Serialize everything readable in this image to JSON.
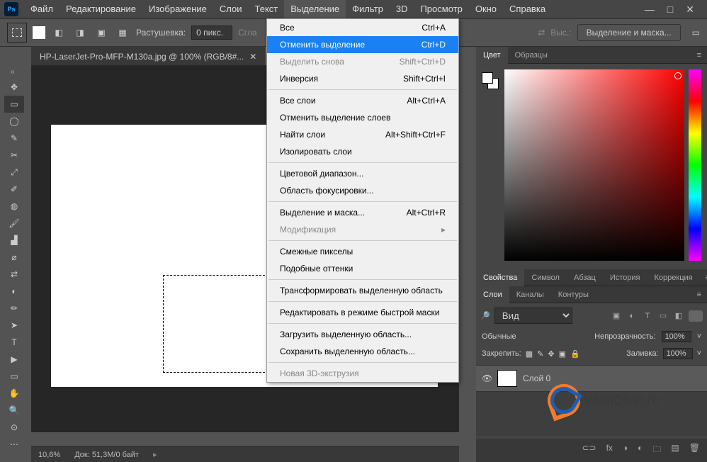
{
  "menubar": {
    "items": [
      "Файл",
      "Редактирование",
      "Изображение",
      "Слои",
      "Текст",
      "Выделение",
      "Фильтр",
      "3D",
      "Просмотр",
      "Окно",
      "Справка"
    ],
    "open_index": 5
  },
  "options": {
    "feather_label": "Растушевка:",
    "feather_value": "0 пикс.",
    "antialias_label": "Сгла",
    "refine_label": "Выс.:",
    "select_mask_btn": "Выделение и маска..."
  },
  "document": {
    "tab": "HP-LaserJet-Pro-MFP-M130a.jpg @ 100% (RGB/8#..."
  },
  "dropdown": {
    "items": [
      {
        "label": "Все",
        "shortcut": "Ctrl+A"
      },
      {
        "label": "Отменить выделение",
        "shortcut": "Ctrl+D",
        "hl": true
      },
      {
        "label": "Выделить снова",
        "shortcut": "Shift+Ctrl+D",
        "dim": true
      },
      {
        "label": "Инверсия",
        "shortcut": "Shift+Ctrl+I"
      },
      {
        "sep": true
      },
      {
        "label": "Все слои",
        "shortcut": "Alt+Ctrl+A"
      },
      {
        "label": "Отменить выделение слоев",
        "shortcut": ""
      },
      {
        "label": "Найти слои",
        "shortcut": "Alt+Shift+Ctrl+F"
      },
      {
        "label": "Изолировать слои",
        "shortcut": ""
      },
      {
        "sep": true
      },
      {
        "label": "Цветовой диапазон...",
        "shortcut": ""
      },
      {
        "label": "Область фокусировки...",
        "shortcut": ""
      },
      {
        "sep": true
      },
      {
        "label": "Выделение и маска...",
        "shortcut": "Alt+Ctrl+R"
      },
      {
        "label": "Модификация",
        "shortcut": "▸",
        "dim": true
      },
      {
        "sep": true
      },
      {
        "label": "Смежные пикселы",
        "shortcut": ""
      },
      {
        "label": "Подобные оттенки",
        "shortcut": ""
      },
      {
        "sep": true
      },
      {
        "label": "Трансформировать выделенную область",
        "shortcut": ""
      },
      {
        "sep": true
      },
      {
        "label": "Редактировать в режиме быстрой маски",
        "shortcut": ""
      },
      {
        "sep": true
      },
      {
        "label": "Загрузить выделенную область...",
        "shortcut": ""
      },
      {
        "label": "Сохранить выделенную область...",
        "shortcut": ""
      },
      {
        "sep": true
      },
      {
        "label": "Новая 3D-экструзия",
        "shortcut": "",
        "dim": true
      }
    ]
  },
  "panels": {
    "color": {
      "tabs": [
        "Цвет",
        "Образцы"
      ],
      "active": 0
    },
    "mid": {
      "tabs": [
        "Свойства",
        "Символ",
        "Абзац",
        "История",
        "Коррекция"
      ],
      "active": 0
    },
    "layers": {
      "tabs": [
        "Слои",
        "Каналы",
        "Контуры"
      ],
      "active": 0,
      "filter_kind": "Вид",
      "blend": "Обычные",
      "opacity_label": "Непрозрачность:",
      "opacity": "100%",
      "lock_label": "Закрепить:",
      "fill_label": "Заливка:",
      "fill": "100%",
      "layer0": "Слой 0",
      "search_glyph": "🔎"
    }
  },
  "status": {
    "zoom": "10,6%",
    "doc": "Док: 51,3M/0 байт"
  },
  "watermark": "WamOtvet.ru",
  "toolbar_icons": [
    "✥",
    "▭",
    "◯",
    "✎",
    "✂",
    "⤢",
    "✐",
    "◍",
    "🖌",
    "▟",
    "⌀",
    "⇄",
    "◐",
    "✏",
    "➤",
    "T",
    "▶",
    "▭",
    "✋",
    "🔍",
    "⊙",
    "⋯"
  ]
}
